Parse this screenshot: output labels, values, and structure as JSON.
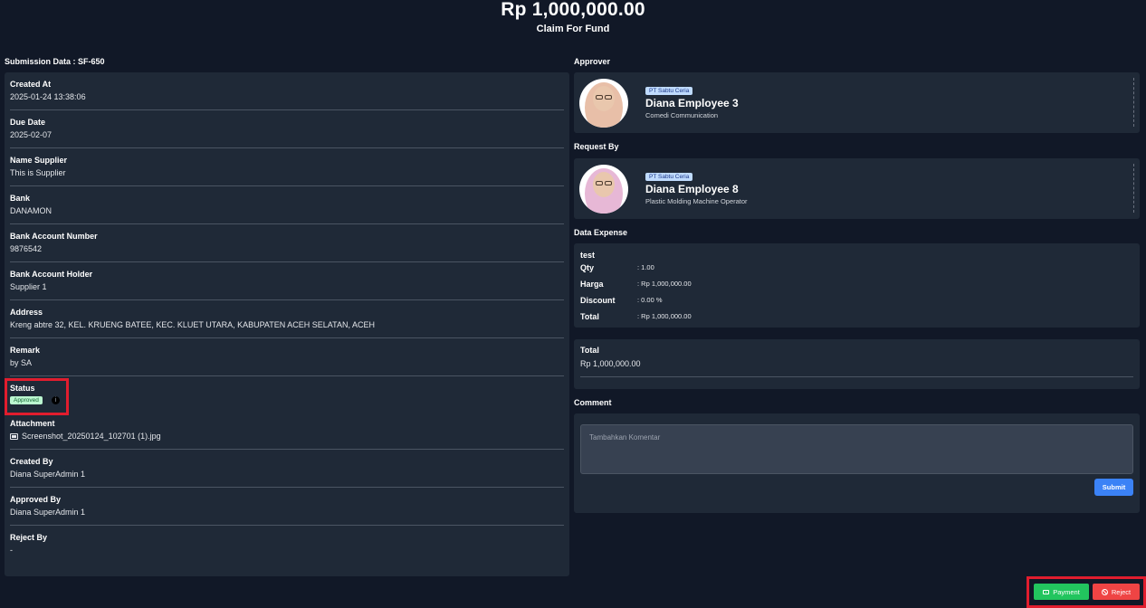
{
  "header": {
    "amount": "Rp 1,000,000.00",
    "subtitle": "Claim For Fund"
  },
  "submission": {
    "title": "Submission Data : SF-650",
    "fields": [
      {
        "label": "Created At",
        "value": "2025-01-24 13:38:06"
      },
      {
        "label": "Due Date",
        "value": "2025-02-07"
      },
      {
        "label": "Name Supplier",
        "value": "This is Supplier"
      },
      {
        "label": "Bank",
        "value": "DANAMON"
      },
      {
        "label": "Bank Account Number",
        "value": "9876542"
      },
      {
        "label": "Bank Account Holder",
        "value": "Supplier 1"
      },
      {
        "label": "Address",
        "value": "Kreng abtre 32, KEL. KRUENG BATEE, KEC. KLUET UTARA, KABUPATEN ACEH SELATAN, ACEH"
      },
      {
        "label": "Remark",
        "value": "by SA"
      }
    ],
    "status": {
      "label": "Status",
      "badge": "Approved",
      "info_icon": "info-circle-icon",
      "badge_color": "#bbf7d0"
    },
    "attachment": {
      "label": "Attachment",
      "icon": "image-icon",
      "filename": "Screenshot_20250124_102701 (1).jpg"
    },
    "created_by": {
      "label": "Created By",
      "value": "Diana SuperAdmin 1"
    },
    "approved_by": {
      "label": "Approved By",
      "value": "Diana SuperAdmin 1"
    },
    "reject_by": {
      "label": "Reject By",
      "value": "-"
    }
  },
  "approver": {
    "title": "Approver",
    "company": "PT Sabtu Ceria",
    "name": "Diana Employee 3",
    "role": "Comedi Communication",
    "hijab_color": "#e8bfa8"
  },
  "requester": {
    "title": "Request By",
    "company": "PT Sabtu Ceria",
    "name": "Diana Employee 8",
    "role": "Plastic Molding Machine Operator",
    "hijab_color": "#e7b8d6"
  },
  "expense": {
    "title": "Data Expense",
    "item_name": "test",
    "rows": [
      {
        "label": "Qty",
        "value": ": 1.00"
      },
      {
        "label": "Harga",
        "value": ": Rp 1,000,000.00"
      },
      {
        "label": "Discount",
        "value": ": 0.00 %"
      },
      {
        "label": "Total",
        "value": ": Rp 1,000,000.00"
      }
    ]
  },
  "total": {
    "label": "Total",
    "value": "Rp 1,000,000.00"
  },
  "comment": {
    "title": "Comment",
    "placeholder": "Tambahkan Komentar",
    "submit_label": "Submit"
  },
  "actions": {
    "payment_label": "Payment",
    "payment_icon": "cash-icon",
    "reject_label": "Reject",
    "reject_icon": "ban-icon"
  },
  "colors": {
    "background": "#111827",
    "panel": "#1f2937",
    "highlight": "#e11d2e",
    "payment": "#22c55e",
    "reject": "#ef4444",
    "submit": "#3b82f6"
  }
}
